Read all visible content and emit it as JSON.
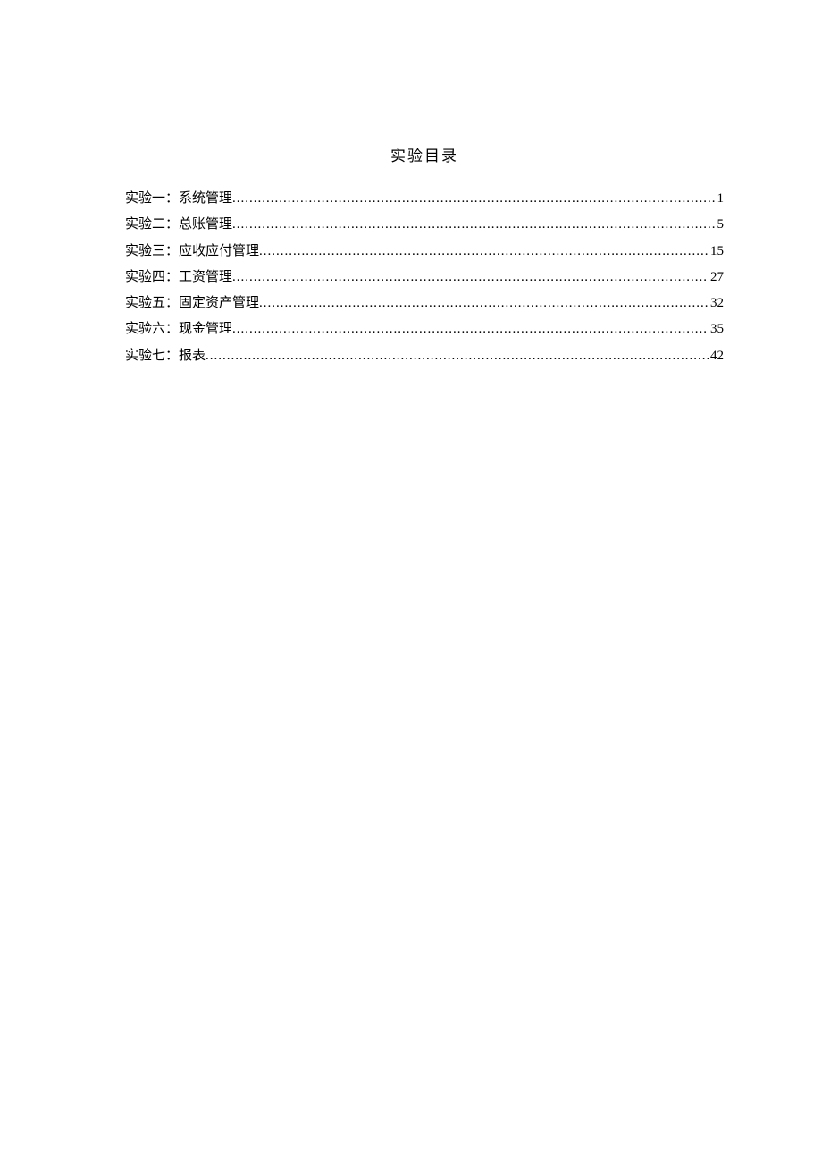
{
  "title": "实验目录",
  "entries": [
    {
      "label": "实验一：系统管理",
      "page": "1"
    },
    {
      "label": "实验二：总账管理",
      "page": "5"
    },
    {
      "label": "实验三：应收应付管理",
      "page": "15"
    },
    {
      "label": "实验四：工资管理",
      "page": "27"
    },
    {
      "label": "实验五：固定资产管理",
      "page": "32"
    },
    {
      "label": "实验六：现金管理",
      "page": "35"
    },
    {
      "label": "实验七：报表",
      "page": "42"
    }
  ]
}
